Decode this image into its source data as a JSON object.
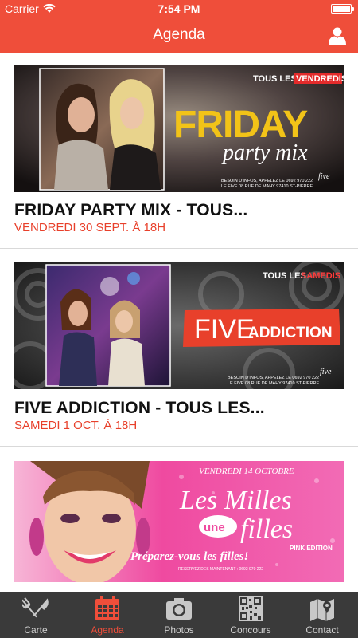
{
  "status": {
    "carrier": "Carrier",
    "time": "7:54 PM"
  },
  "header": {
    "title": "Agenda",
    "icon": "user-icon"
  },
  "events": [
    {
      "name": "FRIDAY PARTY MIX - TOUS...",
      "date": "VENDREDI 30 SEPT. À 18H",
      "banner": {
        "top": "TOUS LES",
        "top_highlight": "VENDREDIS",
        "title": "FRIDAY",
        "subtitle": "party mix",
        "info1": "BESOIN D'INFOS, APPELEZ LE 0692 970 222",
        "info2": "LE FIVE 08 RUE DE MAHY 97410 ST-PIERRE",
        "logo": "five"
      }
    },
    {
      "name": "FIVE ADDICTION - TOUS LES...",
      "date": "SAMEDI 1 OCT. À 18H",
      "banner": {
        "top": "TOUS LES",
        "top_highlight": "SAMEDIS",
        "title_a": "FIVE",
        "title_b": "ADDICTION",
        "info1": "BESOIN D'INFOS, APPELEZ LE 0692 970 222",
        "info2": "LE FIVE 08 RUE DE MAHY 97410 ST-PIERRE",
        "logo": "five"
      }
    },
    {
      "banner": {
        "top": "VENDREDI 14 OCTOBRE",
        "title_a": "Les Milles",
        "title_b": "filles",
        "badge": "une",
        "edition": "PINK EDITION",
        "slogan": "Préparez-vous les filles!",
        "info": "RESERVEZ DES MAINTENANT : 0692 970 222"
      }
    }
  ],
  "tabs": [
    {
      "label": "Carte",
      "icon": "cutlery-icon",
      "active": false
    },
    {
      "label": "Agenda",
      "icon": "calendar-icon",
      "active": true
    },
    {
      "label": "Photos",
      "icon": "camera-icon",
      "active": false
    },
    {
      "label": "Concours",
      "icon": "qr-code-icon",
      "active": false
    },
    {
      "label": "Contact",
      "icon": "map-icon",
      "active": false
    }
  ],
  "colors": {
    "accent": "#ef4e3a",
    "tabbar": "#3a3a3a",
    "date": "#e8402b",
    "friday_yellow": "#f2c318",
    "pink": "#ef4aa0"
  }
}
